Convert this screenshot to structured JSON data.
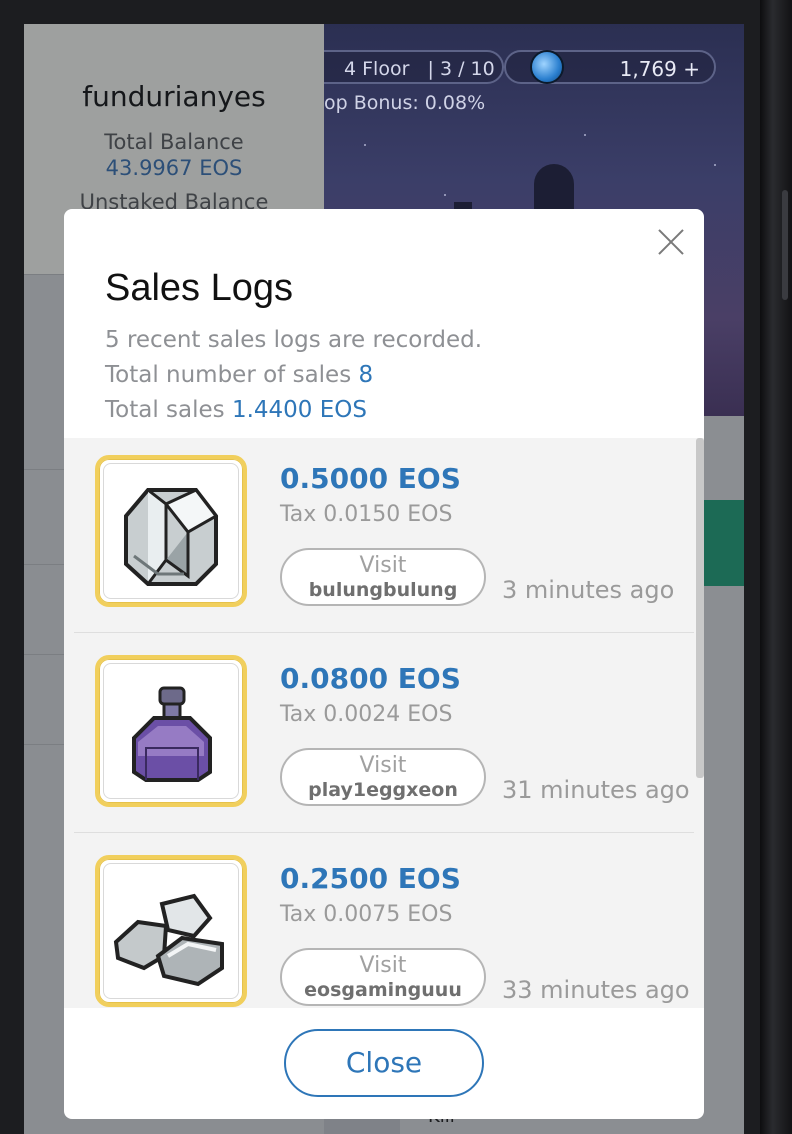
{
  "background": {
    "user": {
      "name": "fundurianyes",
      "total_balance_label": "Total Balance",
      "total_balance_value": "43.9967 EOS",
      "unstaked_balance_label": "Unstaked Balance"
    },
    "floor_text": "4 Floor",
    "floor_progress": "| 3 / 10",
    "bonus_text": "op Bonus: 0.08%",
    "gems": "1,769 +",
    "kill_label": "Kill"
  },
  "modal": {
    "title": "Sales Logs",
    "recent_note": "5 recent sales logs are recorded.",
    "total_number_label": "Total number of sales",
    "total_number_value": "8",
    "total_sales_label": "Total sales",
    "total_sales_value": "1.4400 EOS",
    "close_label": "Close",
    "items": [
      {
        "icon": "silver-ingots-icon",
        "price": "0.5000 EOS",
        "tax": "Tax 0.0150 EOS",
        "visit": "Visit",
        "account": "bulungbulung",
        "time": "3 minutes ago"
      },
      {
        "icon": "purple-potion-bottle-icon",
        "price": "0.0800 EOS",
        "tax": "Tax 0.0024 EOS",
        "visit": "Visit",
        "account": "play1eggxeon",
        "time": "31 minutes ago"
      },
      {
        "icon": "silver-ore-chunks-icon",
        "price": "0.2500 EOS",
        "tax": "Tax 0.0075 EOS",
        "visit": "Visit",
        "account": "eosgaminguuu",
        "time": "33 minutes ago"
      }
    ]
  },
  "colors": {
    "accent": "#2e76b8",
    "thumb_border": "#f1cf5c",
    "teal": "#1c6a55"
  }
}
